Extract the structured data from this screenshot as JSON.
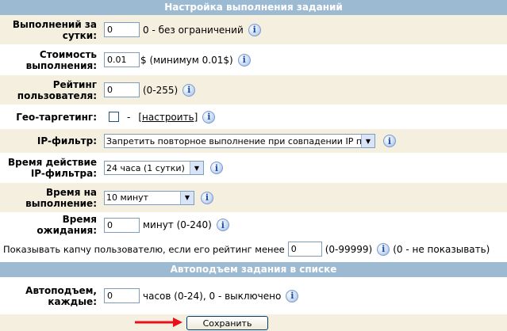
{
  "section1_title": "Настройка выполнения заданий",
  "rows": {
    "daily": {
      "label": "Выполнений за сутки:",
      "value": "0",
      "note": "0 - без ограничений"
    },
    "cost": {
      "label": "Стоимость выполнения:",
      "value": "0.01",
      "note": "$ (минимум 0.01$)"
    },
    "rating": {
      "label": "Рейтинг пользователя:",
      "value": "0",
      "note": "(0-255)"
    },
    "geo": {
      "label": "Гео-таргетинг:",
      "dash": "-",
      "link": "[настроить]"
    },
    "ip": {
      "label": "IP-фильтр:",
      "selected": "Запретить повторное выполнение при совпадении IP по маске"
    },
    "ip_time": {
      "label": "Время действие IP-фильтра:",
      "selected": "24 часа (1 сутки)"
    },
    "exec_time": {
      "label": "Время на выполнение:",
      "selected": "10 минут"
    },
    "wait": {
      "label": "Время ожидания:",
      "value": "0",
      "note": "минут (0-240)"
    }
  },
  "captcha": {
    "text": "Показывать капчу пользователю, если его рейтинг менее",
    "value": "0",
    "range": "(0-99999)",
    "note": "(0 - не показывать)"
  },
  "section2_title": "Автоподъем задания в списке",
  "autoup": {
    "label": "Автоподъем, каждые:",
    "value": "0",
    "note": "часов (0-24), 0 - выключено"
  },
  "save_label": "Сохранить",
  "info_glyph": "i",
  "colors": {
    "header": "#9dbad3",
    "beige": "#f4efdf",
    "arrow": "#e8101b"
  }
}
